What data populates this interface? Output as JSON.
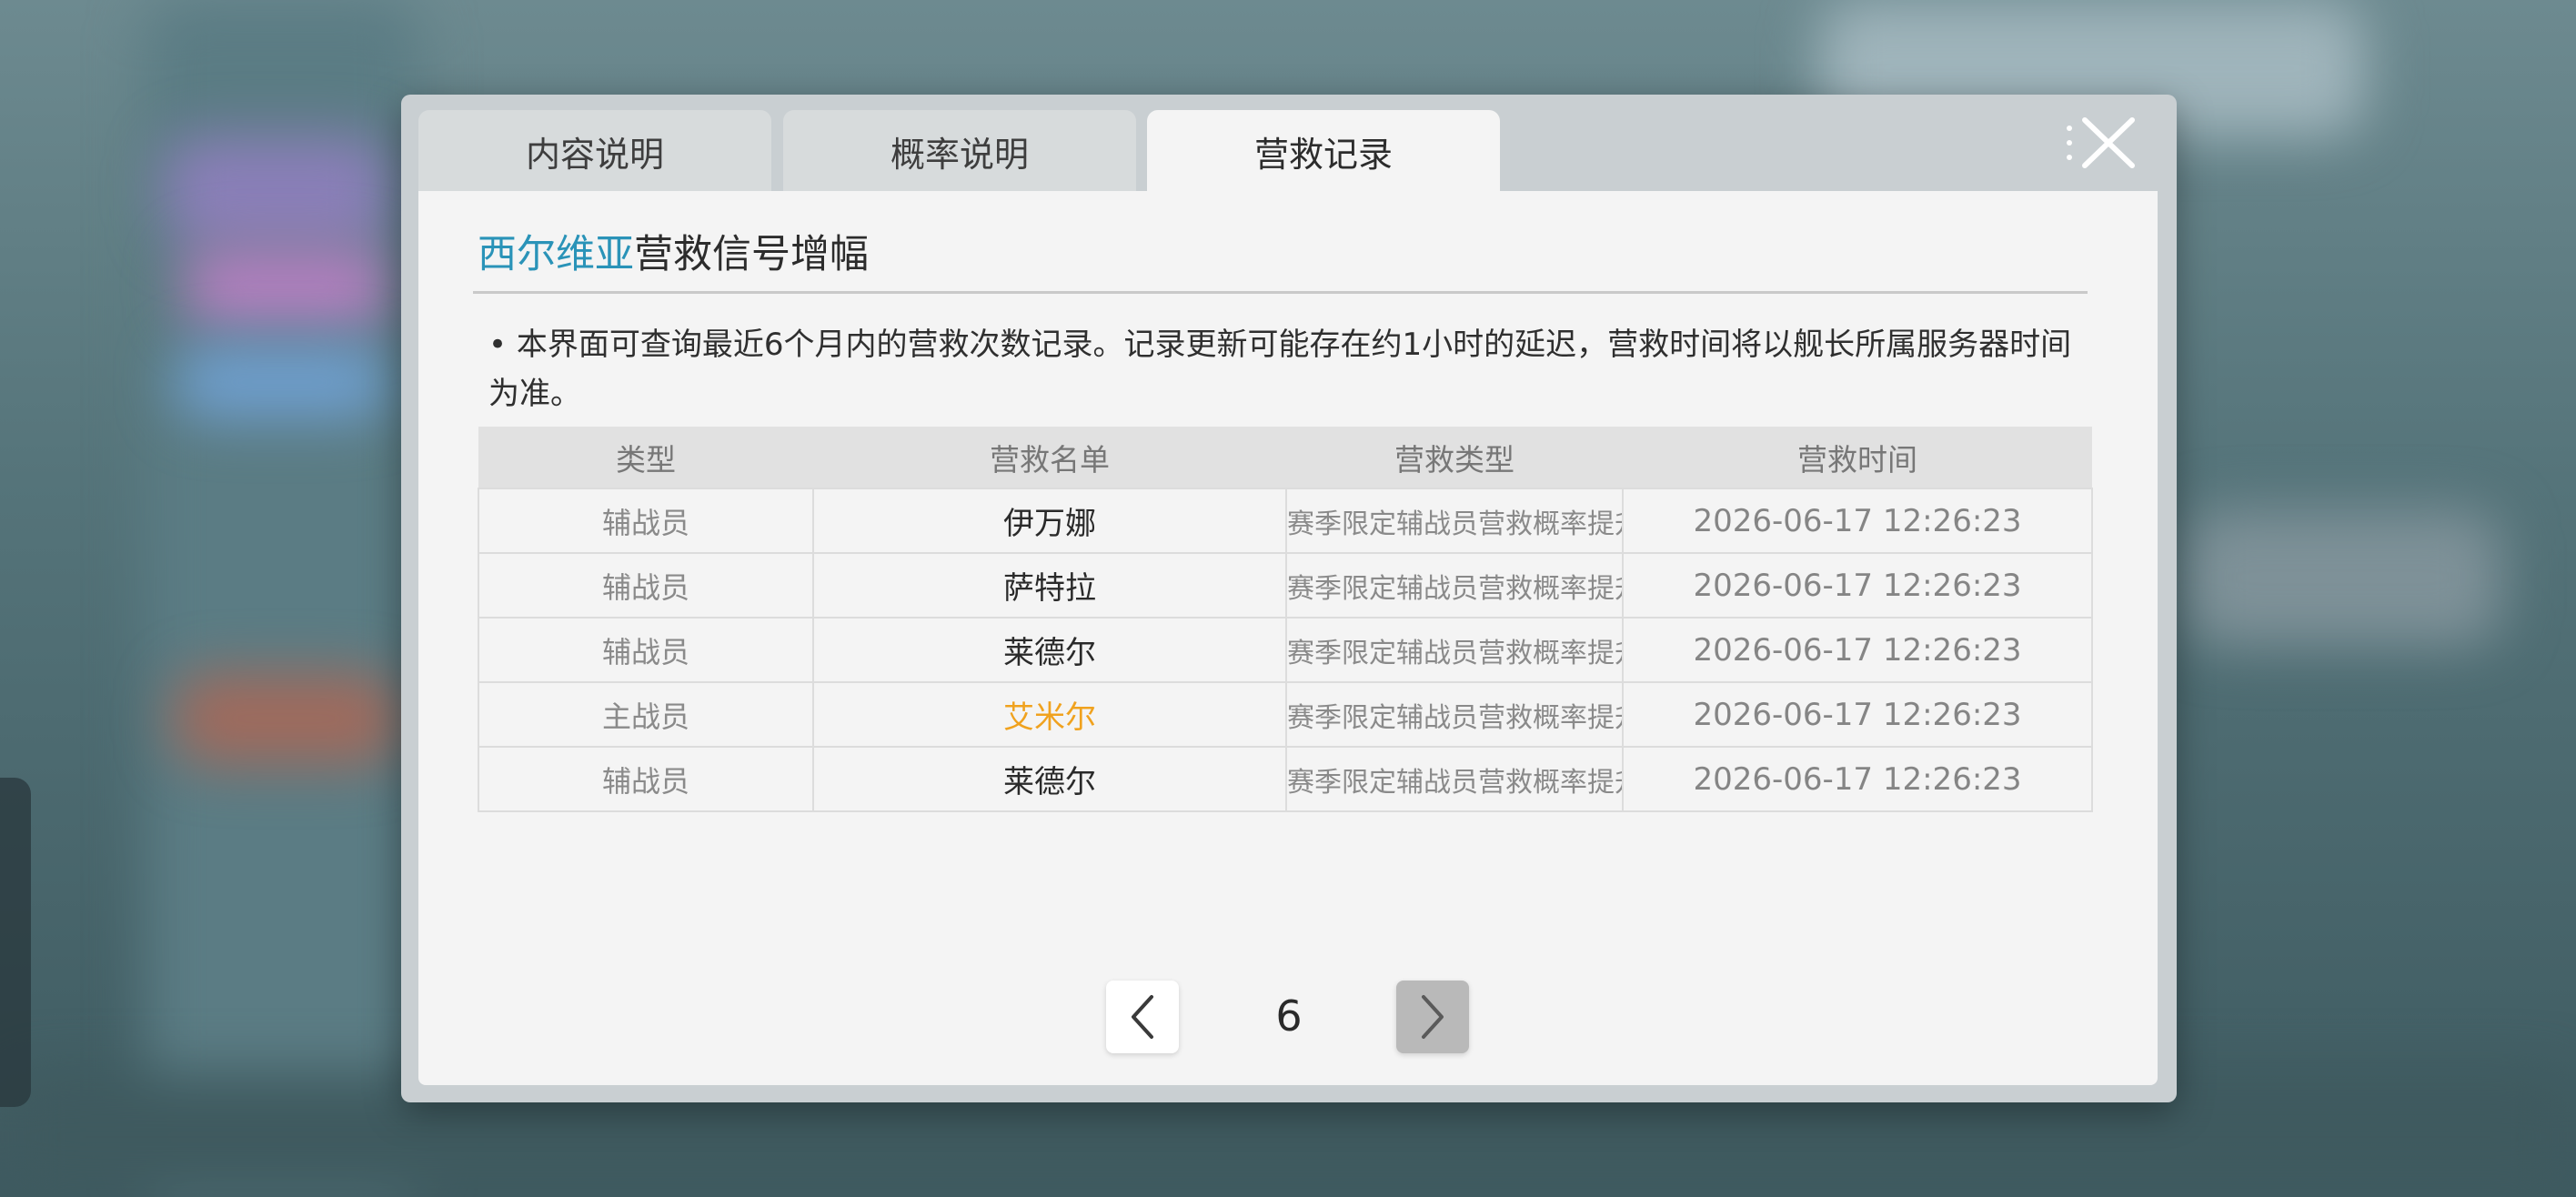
{
  "tabs": [
    {
      "label": "内容说明",
      "active": false
    },
    {
      "label": "概率说明",
      "active": false
    },
    {
      "label": "营救记录",
      "active": true
    }
  ],
  "title": {
    "highlight": "西尔维亚",
    "rest": "营救信号增幅",
    "highlight_color": "#2a93b8"
  },
  "notice": "• 本界面可查询最近6个月内的营救次数记录。记录更新可能存在约1小时的延迟，营救时间将以舰长所属服务器时间为准。",
  "table": {
    "headers": [
      "类型",
      "营救名单",
      "营救类型",
      "营救时间"
    ],
    "rows": [
      {
        "type": "辅战员",
        "name": "伊万娜",
        "rescue_type": "赛季限定辅战员营救概率提升",
        "time": "2026-06-17 12:26:23"
      },
      {
        "type": "辅战员",
        "name": "萨特拉",
        "rescue_type": "赛季限定辅战员营救概率提升",
        "time": "2026-06-17 12:26:23"
      },
      {
        "type": "辅战员",
        "name": "莱德尔",
        "rescue_type": "赛季限定辅战员营救概率提升",
        "time": "2026-06-17 12:26:23"
      },
      {
        "type": "主战员",
        "name": "艾米尔",
        "rescue_type": "赛季限定辅战员营救概率提升",
        "time": "2026-06-17 12:26:23",
        "rare": true
      },
      {
        "type": "辅战员",
        "name": "莱德尔",
        "rescue_type": "赛季限定辅战员营救概率提升",
        "time": "2026-06-17 12:26:23"
      }
    ]
  },
  "pagination": {
    "current_page": "6",
    "prev_icon": "chevron-left-icon",
    "next_icon": "chevron-right-icon"
  },
  "colors": {
    "rare_name": "#f0a21e",
    "accent": "#2a93b8"
  },
  "icons": {
    "close": "close-icon"
  }
}
